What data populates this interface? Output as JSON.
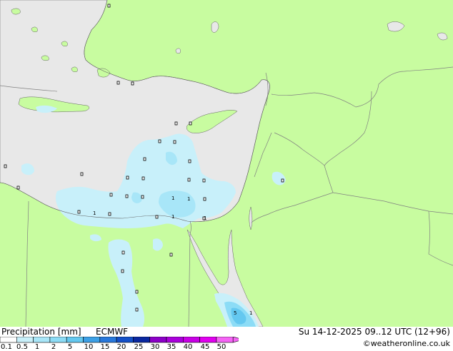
{
  "header": {
    "title": "Precipitation [mm]",
    "model": "ECMWF",
    "datetime": "Su 14-12-2025 09..12 UTC (12+96)",
    "credit": "©weatheronline.co.uk"
  },
  "legend": {
    "ticks": [
      "0.1",
      "0.5",
      "1",
      "2",
      "5",
      "10",
      "15",
      "20",
      "25",
      "30",
      "35",
      "40",
      "45",
      "50"
    ],
    "colors": [
      "#ffffff",
      "#c8f0fa",
      "#a8e6f8",
      "#8cdcf6",
      "#64c8f0",
      "#3ca0e6",
      "#2878dc",
      "#1450c8",
      "#0a28a0",
      "#8c00c8",
      "#aa00dc",
      "#c800e6",
      "#e100f0",
      "#f564f5"
    ]
  },
  "map": {
    "colors": {
      "sea": "#e8e8e8",
      "land": "#c8fca0",
      "border": "#808080",
      "coast": "#606060"
    },
    "point_labels": [
      "1",
      "1",
      "1",
      "1",
      "1",
      "5",
      "1"
    ]
  }
}
